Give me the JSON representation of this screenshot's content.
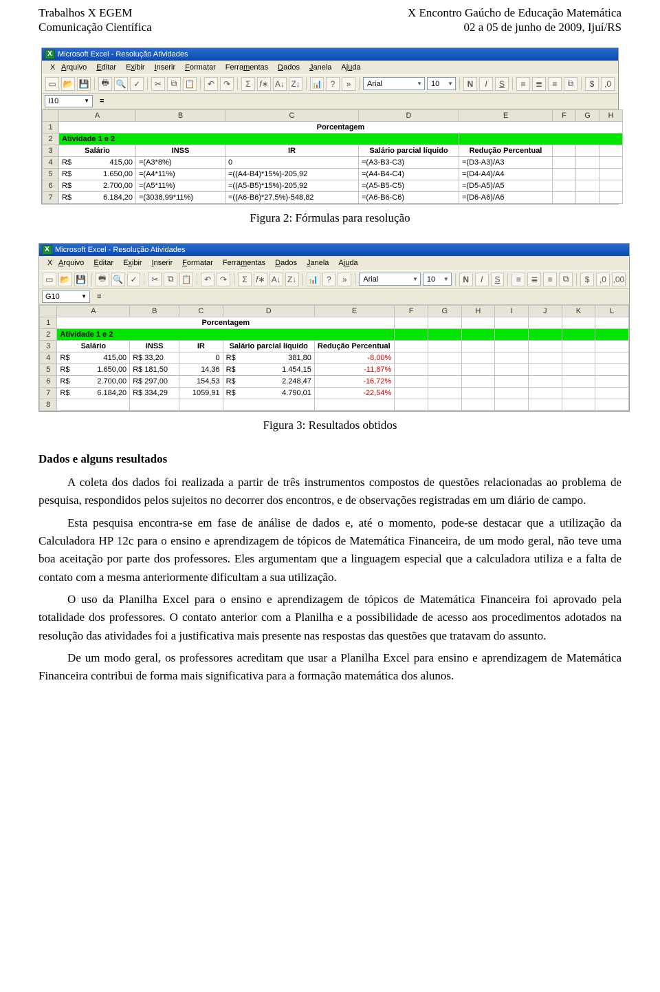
{
  "header": {
    "left1": "Trabalhos X EGEM",
    "left2": "Comunicação Científica",
    "right1": "X Encontro Gaúcho de Educação Matemática",
    "right2": "02 a 05 de junho de 2009, Ijuí/RS"
  },
  "excel1": {
    "title": "Microsoft Excel - Resolução Atividades",
    "menus": [
      "Arquivo",
      "Editar",
      "Exibir",
      "Inserir",
      "Formatar",
      "Ferramentas",
      "Dados",
      "Janela",
      "Ajuda"
    ],
    "font_name": "Arial",
    "font_size": "10",
    "cellref": "I10",
    "cols": [
      "A",
      "B",
      "C",
      "D",
      "E",
      "F",
      "G",
      "H"
    ],
    "row1_center": "Porcentagem",
    "row2_a": "Atividade 1 e 2",
    "hdr": {
      "a": "Salário",
      "b": "INSS",
      "c": "IR",
      "d": "Salário parcial líquido",
      "e": "Redução Percentual"
    },
    "rows": [
      {
        "n": "4",
        "a": "R$",
        "aval": "415,00",
        "b": "=(A3*8%)",
        "c": "0",
        "d": "=(A3-B3-C3)",
        "e": "=(D3-A3)/A3"
      },
      {
        "n": "5",
        "a": "R$",
        "aval": "1.650,00",
        "b": "=(A4*11%)",
        "c": "=((A4-B4)*15%)-205,92",
        "d": "=(A4-B4-C4)",
        "e": "=(D4-A4)/A4"
      },
      {
        "n": "6",
        "a": "R$",
        "aval": "2.700,00",
        "b": "=(A5*11%)",
        "c": "=((A5-B5)*15%)-205,92",
        "d": "=(A5-B5-C5)",
        "e": "=(D5-A5)/A5"
      },
      {
        "n": "7",
        "a": "R$",
        "aval": "6.184,20",
        "b": "=(3038,99*11%)",
        "c": "=((A6-B6)*27,5%)-548,82",
        "d": "=(A6-B6-C6)",
        "e": "=(D6-A6)/A6"
      }
    ]
  },
  "caption1": "Figura 2: Fórmulas para resolução",
  "excel2": {
    "title": "Microsoft Excel - Resolução Atividades",
    "menus": [
      "Arquivo",
      "Editar",
      "Exibir",
      "Inserir",
      "Formatar",
      "Ferramentas",
      "Dados",
      "Janela",
      "Ajuda"
    ],
    "font_name": "Arial",
    "font_size": "10",
    "cellref": "G10",
    "cols": [
      "A",
      "B",
      "C",
      "D",
      "E",
      "F",
      "G",
      "H",
      "I",
      "J",
      "K",
      "L"
    ],
    "row1_center": "Porcentagem",
    "row2_a": "Atividade 1 e 2",
    "hdr": {
      "a": "Salário",
      "b": "INSS",
      "c": "IR",
      "d": "Salário parcial líquido",
      "e": "Redução Percentual"
    },
    "rows": [
      {
        "n": "4",
        "a": "R$",
        "aval": "415,00",
        "b": "R$   33,20",
        "c": "0",
        "d": "R$",
        "dval": "381,80",
        "e": "-8,00%"
      },
      {
        "n": "5",
        "a": "R$",
        "aval": "1.650,00",
        "b": "R$ 181,50",
        "c": "14,36",
        "d": "R$",
        "dval": "1.454,15",
        "e": "-11,87%"
      },
      {
        "n": "6",
        "a": "R$",
        "aval": "2.700,00",
        "b": "R$ 297,00",
        "c": "154,53",
        "d": "R$",
        "dval": "2.248,47",
        "e": "-16,72%"
      },
      {
        "n": "7",
        "a": "R$",
        "aval": "6.184,20",
        "b": "R$ 334,29",
        "c": "1059,91",
        "d": "R$",
        "dval": "4.790,01",
        "e": "-22,54%"
      }
    ],
    "row8": "8"
  },
  "caption2": "Figura 3: Resultados obtidos",
  "body": {
    "h": "Dados e alguns resultados",
    "p1": "A coleta dos dados foi realizada a partir de três instrumentos compostos de questões relacionadas ao problema de pesquisa, respondidos pelos sujeitos no decorrer dos encontros, e de observações registradas em um diário de campo.",
    "p2": "Esta pesquisa encontra-se em fase de análise de dados e, até o momento, pode-se destacar que a utilização da Calculadora HP 12c para o ensino e aprendizagem de tópicos de Matemática Financeira, de um modo geral, não teve uma boa aceitação por parte dos professores. Eles argumentam que a linguagem especial que a calculadora utiliza e a falta de contato com a mesma anteriormente dificultam a sua utilização.",
    "p3": "O uso da Planilha Excel para o ensino e aprendizagem de tópicos de Matemática Financeira foi aprovado pela totalidade dos professores. O contato anterior com a Planilha e a possibilidade de acesso aos procedimentos adotados na resolução das atividades foi a justificativa mais presente nas respostas das questões que tratavam do assunto.",
    "p4": "De um modo geral, os professores acreditam que usar a Planilha Excel para ensino e aprendizagem de Matemática Financeira contribui de forma mais significativa para a formação matemática dos alunos."
  }
}
